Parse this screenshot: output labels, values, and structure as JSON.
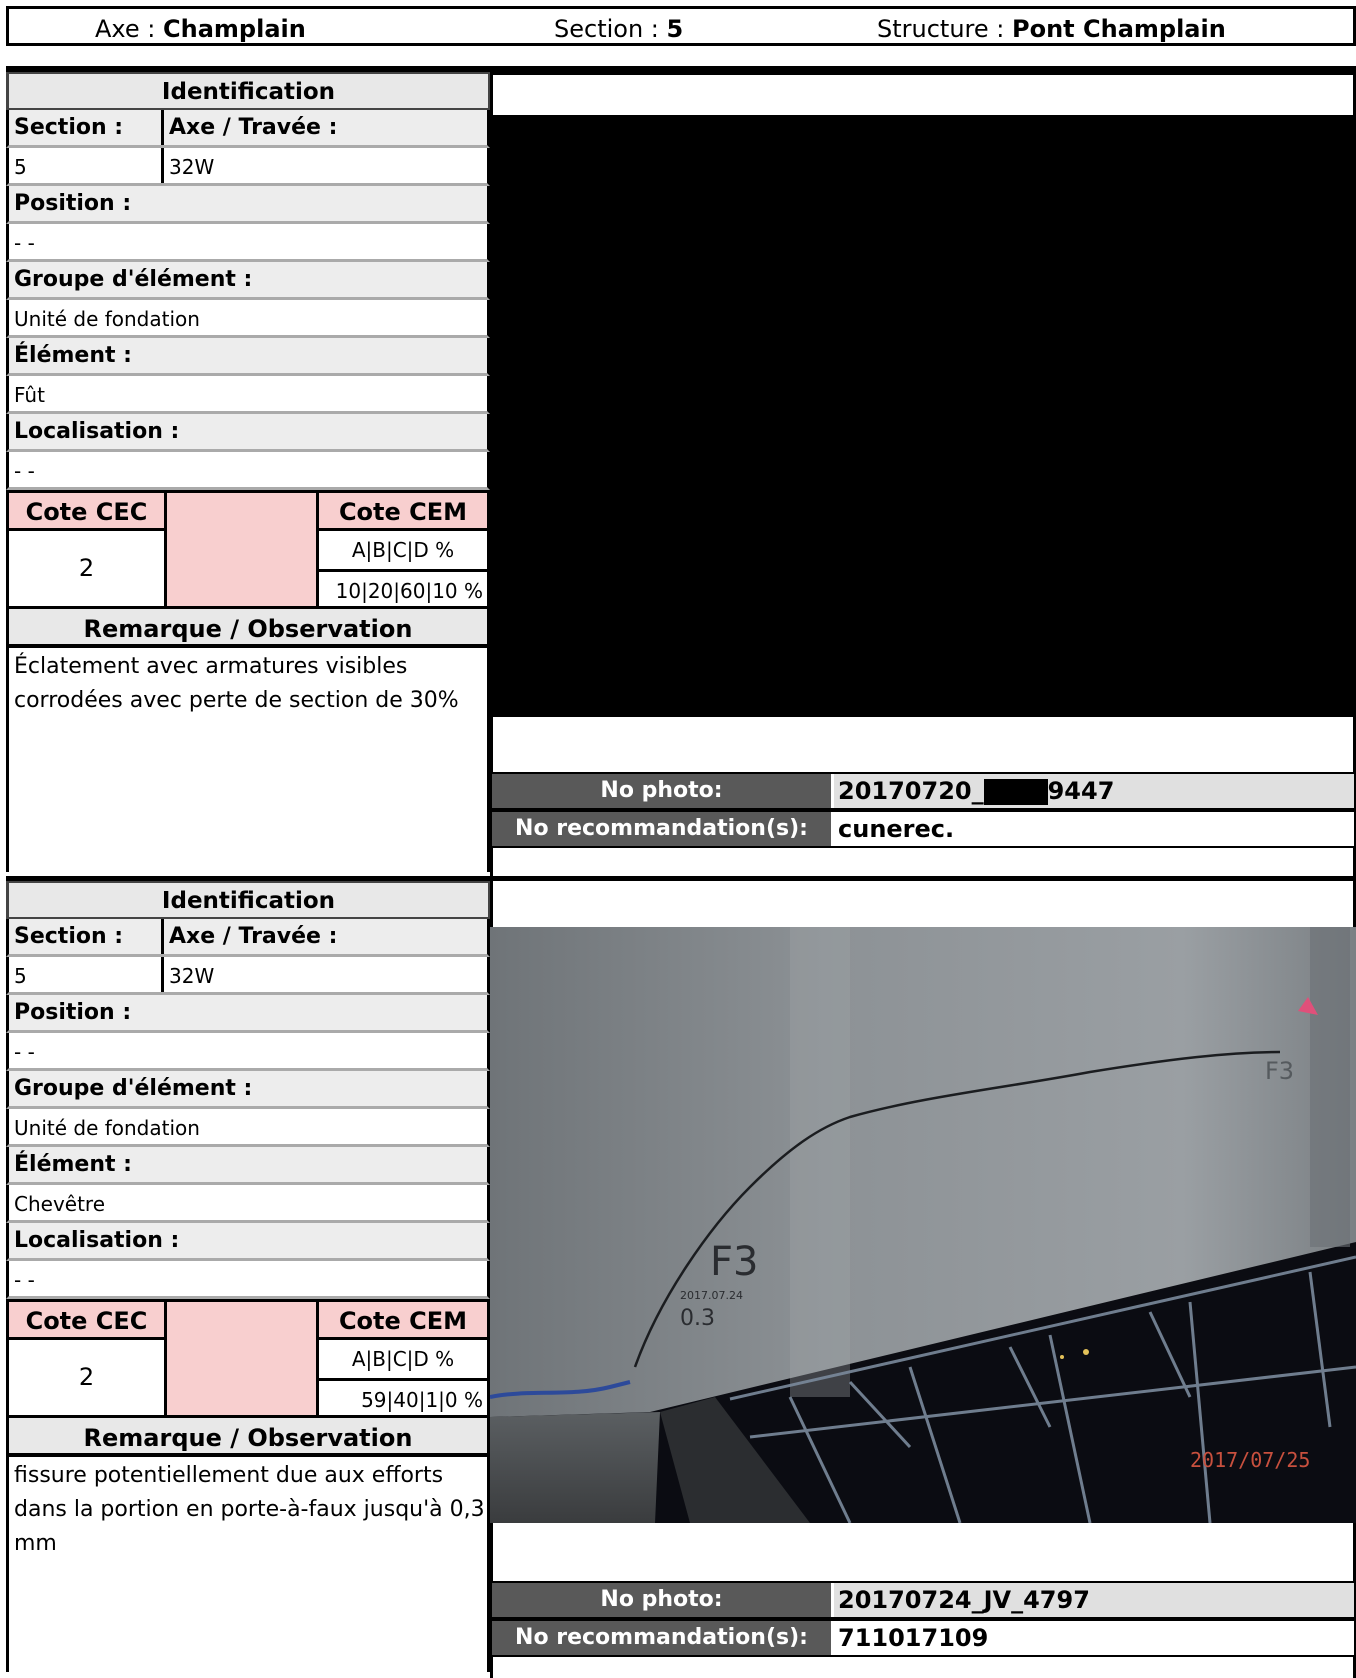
{
  "header": {
    "axe_label": "Axe :",
    "axe_value": "Champlain",
    "section_label": "Section :",
    "section_value": "5",
    "structure_label": "Structure :",
    "structure_value": "Pont Champlain"
  },
  "labels": {
    "identification": "Identification",
    "section": "Section :",
    "axe_travee": "Axe / Travée :",
    "position": "Position :",
    "groupe": "Groupe d'élément :",
    "element": "Élément :",
    "localisation": "Localisation :",
    "cote_cec": "Cote CEC",
    "cote_cem": "Cote CEM",
    "cem_header": "A|B|C|D %",
    "remarque": "Remarque / Observation",
    "no_photo": "No photo:",
    "no_recommandation": "No recommandation(s):"
  },
  "records": [
    {
      "section": "5",
      "axe_travee": "32W",
      "position": "- -",
      "groupe": "Unité de fondation",
      "element": "Fût",
      "localisation": "- -",
      "cote_cec": "2",
      "cem_values": "10|20|60|10 %",
      "remarque": "Éclatement avec armatures visibles corrodées avec perte de section de 30%",
      "photo_no_a": "20170720_",
      "photo_no_b": "9447",
      "recommandation": "cunerec."
    },
    {
      "section": "5",
      "axe_travee": "32W",
      "position": "- -",
      "groupe": "Unité de fondation",
      "element": "Chevêtre",
      "localisation": "- -",
      "cote_cec": "2",
      "cem_values": "59|40|1|0 %",
      "remarque": "fissure potentiellement due aux efforts dans la portion en porte-à-faux jusqu'à 0,3 mm",
      "photo_no": "20170724_JV_4797",
      "recommandation": "711017109",
      "photo_text": {
        "crack_label_1": "F3",
        "crack_label_2": "F3",
        "marker_date": "2017.07.24",
        "marker_width": "0.3",
        "timestamp": "2017/07/25"
      }
    }
  ]
}
